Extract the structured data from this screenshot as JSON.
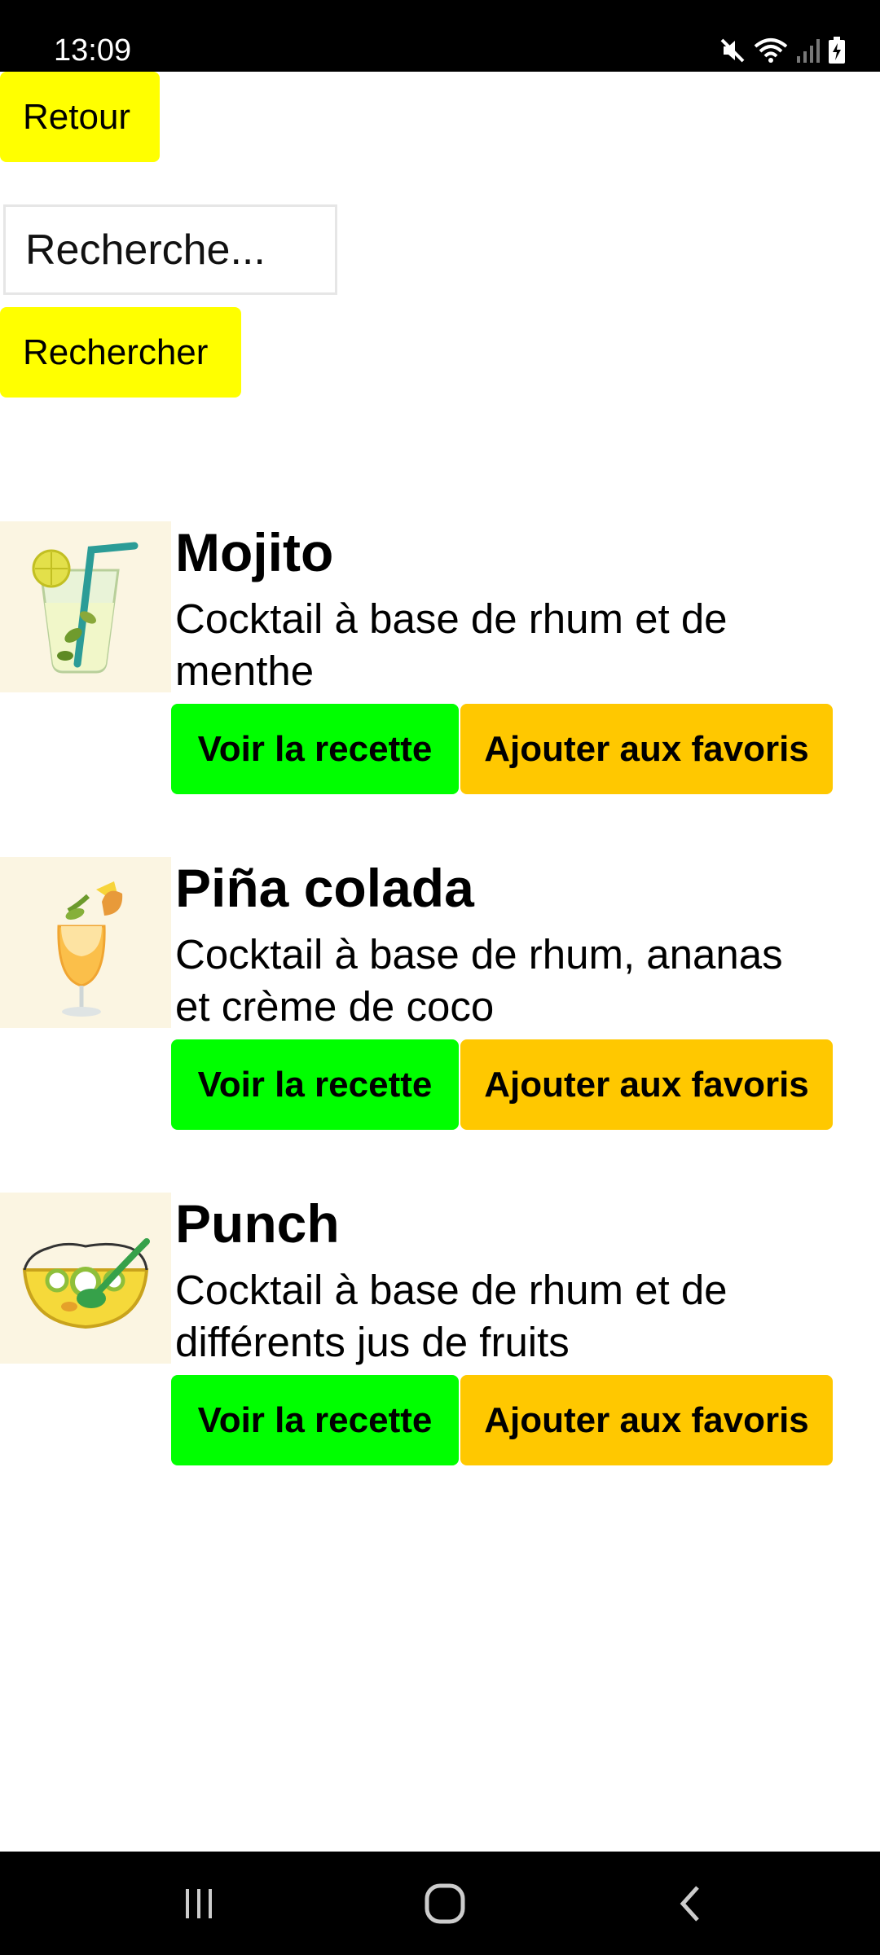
{
  "status_bar": {
    "time": "13:09",
    "icons": [
      "mute-icon",
      "wifi-icon",
      "signal-icon",
      "battery-charging-icon"
    ]
  },
  "header": {
    "back_label": "Retour"
  },
  "search": {
    "placeholder": "Recherche...",
    "value": "",
    "button_label": "Rechercher"
  },
  "cocktails": [
    {
      "name": "Mojito",
      "description": "Cocktail à base de rhum et de\nmenthe",
      "image_icon": "mojito-image",
      "recipe_label": "Voir la recette",
      "favorite_label": "Ajouter aux favoris"
    },
    {
      "name": "Piña colada",
      "description": "Cocktail à base de rhum, ananas\n et crème de coco",
      "image_icon": "pina-colada-image",
      "recipe_label": "Voir la recette",
      "favorite_label": "Ajouter aux favoris"
    },
    {
      "name": "Punch",
      "description": "Cocktail à base de rhum et de\ndifférents jus de fruits",
      "image_icon": "punch-image",
      "recipe_label": "Voir la recette",
      "favorite_label": "Ajouter aux favoris"
    }
  ],
  "colors": {
    "yellow_button": "#ffff00",
    "recipe_button": "#00ff00",
    "favorite_button": "#ffc800",
    "thumb_background": "#fbf5e2"
  },
  "nav_bar": {
    "icons": [
      "recent-apps-icon",
      "home-icon",
      "back-icon"
    ]
  }
}
